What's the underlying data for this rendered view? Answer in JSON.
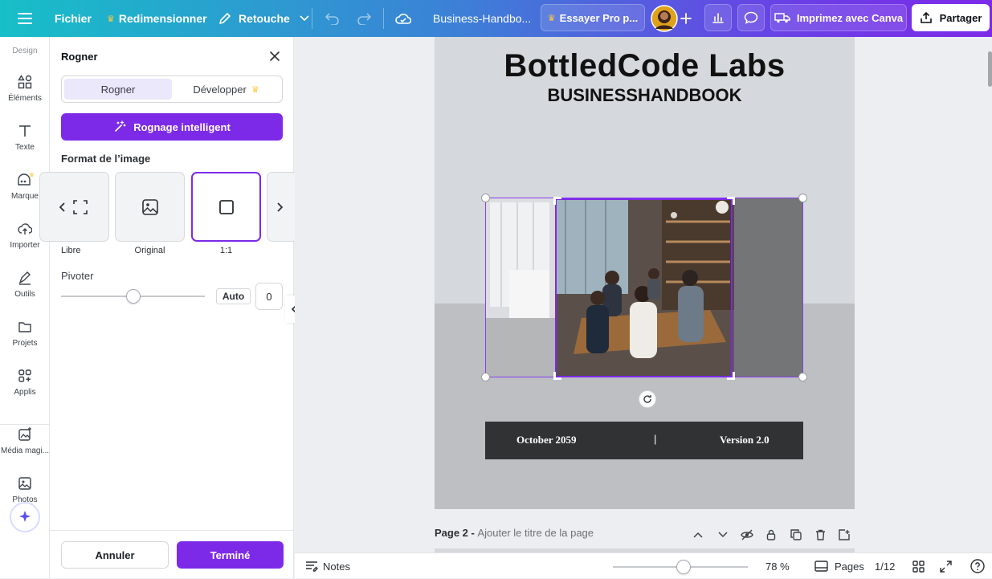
{
  "topbar": {
    "file_label": "Fichier",
    "resize_label": "Redimensionner",
    "retouch_label": "Retouche",
    "doc_title": "Business-Handbo...",
    "try_pro_label": "Essayer Pro p...",
    "print_label": "Imprimez avec Canva",
    "share_label": "Partager"
  },
  "rail": {
    "design_label": "Design",
    "items": [
      {
        "label": "Éléments",
        "icon": "elements-icon"
      },
      {
        "label": "Texte",
        "icon": "text-icon"
      },
      {
        "label": "Marque",
        "icon": "brand-icon"
      },
      {
        "label": "Importer",
        "icon": "upload-cloud-icon"
      },
      {
        "label": "Outils",
        "icon": "pen-tool-icon"
      },
      {
        "label": "Projets",
        "icon": "folder-icon"
      },
      {
        "label": "Applis",
        "icon": "apps-icon"
      },
      {
        "label": "Média magi...",
        "icon": "magic-media-icon"
      },
      {
        "label": "Photos",
        "icon": "photo-icon"
      }
    ]
  },
  "panel": {
    "title": "Rogner",
    "tab_crop": "Rogner",
    "tab_expand": "Développer",
    "smart_crop_label": "Rognage intelligent",
    "format_heading": "Format de l’image",
    "formats": [
      {
        "label": "Libre"
      },
      {
        "label": "Original"
      },
      {
        "label": "1:1"
      }
    ],
    "rotate_label": "Pivoter",
    "auto_label": "Auto",
    "rotate_value": "0",
    "cancel_label": "Annuler",
    "done_label": "Terminé"
  },
  "page1": {
    "company": "BottledCode Labs",
    "subtitle": "BUSINESSHANDBOOK",
    "date": "October 2059",
    "separator": "|",
    "version": "Version 2.0"
  },
  "page2": {
    "label": "Page 2 - ",
    "title_placeholder": "Ajouter le titre de la page"
  },
  "bottombar": {
    "notes_label": "Notes",
    "zoom": "78 %",
    "pages_label": "Pages",
    "page_counter": "1/12"
  },
  "colors": {
    "accent": "#7d2ae8",
    "crown": "#ffc83d",
    "info_bar": "#303234"
  }
}
